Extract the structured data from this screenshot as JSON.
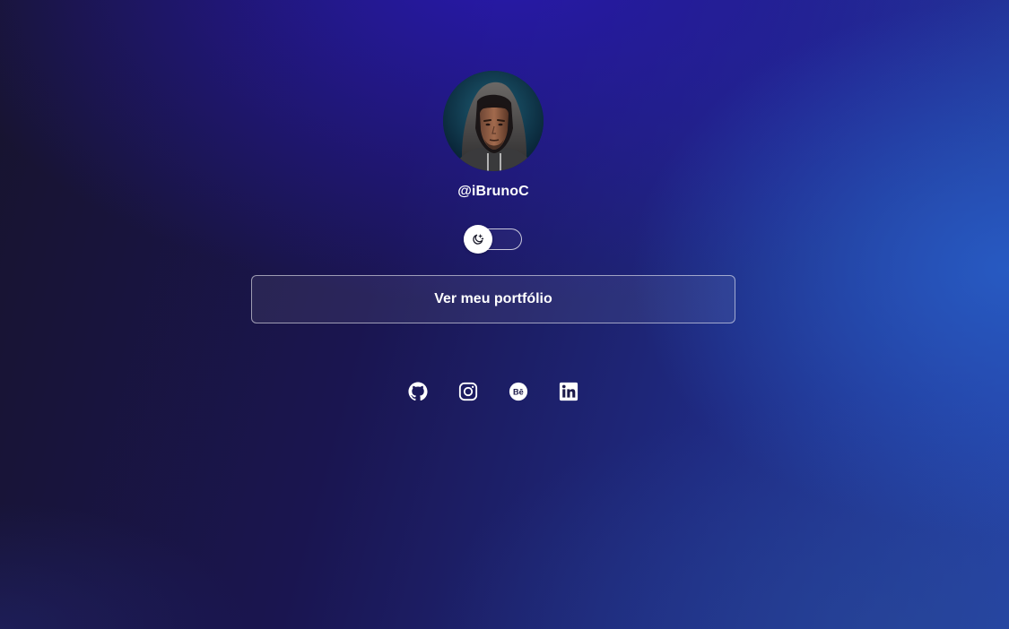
{
  "profile": {
    "username": "@iBrunoC",
    "avatar": "avatar-photo"
  },
  "theme_toggle": {
    "icon": "moon-stars-icon",
    "state": "dark"
  },
  "portfolio_button": {
    "label": "Ver meu portfólio"
  },
  "socials": [
    {
      "icon": "github-icon"
    },
    {
      "icon": "instagram-icon"
    },
    {
      "icon": "behance-icon"
    },
    {
      "icon": "linkedin-icon"
    }
  ],
  "colors": {
    "text": "#ffffff",
    "background_dark": "#17142e",
    "background_accent": "#2542a8"
  }
}
